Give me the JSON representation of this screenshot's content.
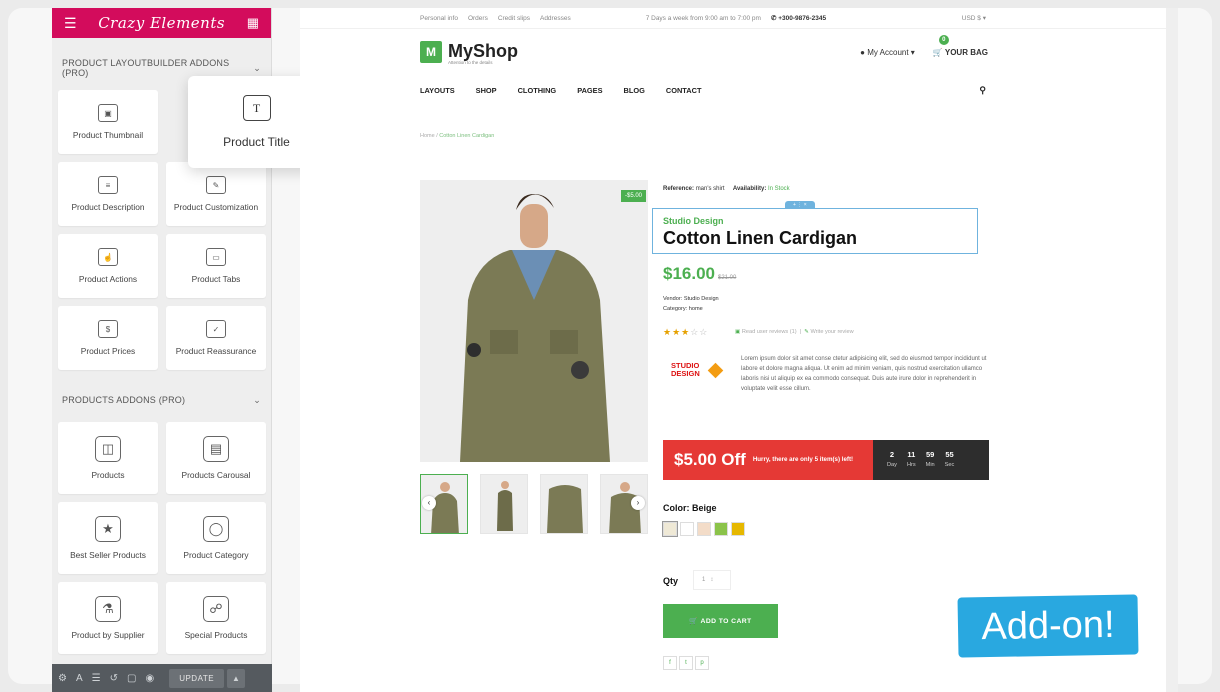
{
  "editor": {
    "brand": "Crazy Elements",
    "section1": "PRODUCT LAYOUTBUILDER ADDONS (PRO)",
    "section1_widgets": [
      "Product Thumbnail",
      "",
      "Product Description",
      "Product Customization",
      "Product Actions",
      "Product Tabs",
      "Product Prices",
      "Product Reassurance"
    ],
    "section2": "PRODUCTS ADDONS (PRO)",
    "section2_widgets": [
      "Products",
      "Products Carousal",
      "Best Seller Products",
      "Product Category",
      "Product by Supplier",
      "Special Products"
    ],
    "update_label": "UPDATE",
    "dragging_widget": "Product Title"
  },
  "shop": {
    "topbar": {
      "links": [
        "Personal info",
        "Orders",
        "Credit slips",
        "Addresses"
      ],
      "hours": "7 Days a week from 9:00 am to 7:00 pm",
      "phone": "+300-9876-2345",
      "currency": "USD $"
    },
    "logo": {
      "letter": "M",
      "name": "MyShop",
      "tagline": "Attention to the details"
    },
    "account": "My Account",
    "bag": "YOUR BAG",
    "bag_count": "0",
    "nav": [
      "LAYOUTS",
      "SHOP",
      "CLOTHING",
      "PAGES",
      "BLOG",
      "CONTACT"
    ],
    "breadcrumb": [
      "Home",
      "Cotton Linen Cardigan"
    ],
    "product": {
      "discount_badge": "-$5.00",
      "reference_label": "Reference:",
      "reference": "man's shirt",
      "availability_label": "Availability:",
      "availability": "In Stock",
      "brand": "Studio Design",
      "title": "Cotton Linen Cardigan",
      "price": "$16.00",
      "old_price": "$21.00",
      "vendor": "Vendor: Studio Design",
      "category": "Category: home",
      "rating": 3,
      "rating_max": 5,
      "read_reviews": "Read user reviews (1)",
      "write_review": "Write your review",
      "brand_logo": [
        "STUDIO",
        "DESIGN"
      ],
      "description": "Lorem ipsum dolor sit amet conse ctetur adipisicing elit, sed do eiusmod tempor incididunt ut labore et dolore magna aliqua. Ut enim ad minim veniam, quis nostrud exercitation ullamco laboris nisi ut aliquip ex ea commodo consequat. Duis aute irure dolor in reprehenderit in voluptate velit esse cillum.",
      "deal_off": "$5.00 Off",
      "deal_text": "Hurry, there are only 5 item(s) left!",
      "countdown": [
        {
          "value": "2",
          "unit": "Day"
        },
        {
          "value": "11",
          "unit": "Hrs"
        },
        {
          "value": "59",
          "unit": "Min"
        },
        {
          "value": "55",
          "unit": "Sec"
        }
      ],
      "color_label": "Color: Beige",
      "swatches": [
        "#efe9d6",
        "#ffffff",
        "#f3dcc8",
        "#8bc34a",
        "#e6b800"
      ],
      "qty_label": "Qty",
      "qty_value": "1",
      "add_to_cart": "ADD TO CART",
      "social": [
        "f",
        "t",
        "p"
      ]
    }
  },
  "addon_banner": "Add-on!"
}
